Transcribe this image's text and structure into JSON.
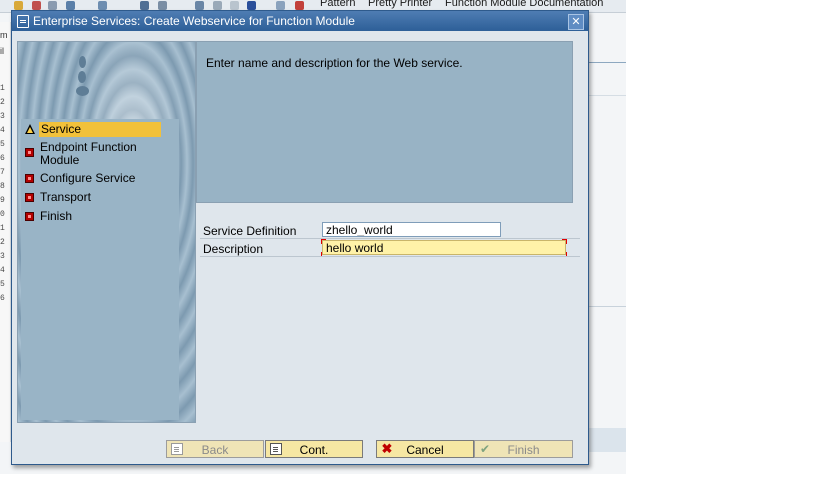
{
  "background_app": {
    "toolbar_items": [
      "Pattern",
      "Pretty Printer",
      "Function Module Documentation"
    ],
    "left_fragments": [
      "m",
      "il"
    ],
    "line_numbers": [
      "1",
      "2",
      "3",
      "4",
      "5",
      "6",
      "7",
      "8",
      "9",
      "0",
      "1",
      "2",
      "3",
      "4",
      "5",
      "6"
    ]
  },
  "dialog": {
    "title": "Enterprise Services: Create Webservice for Function Module",
    "close_glyph": "✕",
    "steps": [
      {
        "label": "Service",
        "status": "warning",
        "active": true
      },
      {
        "label": "Endpoint Function Module",
        "status": "error",
        "active": false
      },
      {
        "label": "Configure Service",
        "status": "error",
        "active": false
      },
      {
        "label": "Transport",
        "status": "error",
        "active": false
      },
      {
        "label": "Finish",
        "status": "error",
        "active": false
      }
    ],
    "instruction": "Enter name and description for the Web service.",
    "fields": {
      "service_definition": {
        "label": "Service Definition",
        "value": "zhello_world"
      },
      "description": {
        "label": "Description",
        "value": "hello world"
      }
    },
    "buttons": {
      "back": "Back",
      "cont": "Cont.",
      "cancel": "Cancel",
      "finish": "Finish"
    }
  },
  "colors": {
    "titlebar": "#2d5f98",
    "active_step": "#f2c13a",
    "panel": "#98b3c5",
    "button": "#f6e7a3",
    "required_field": "#fff2a8"
  }
}
